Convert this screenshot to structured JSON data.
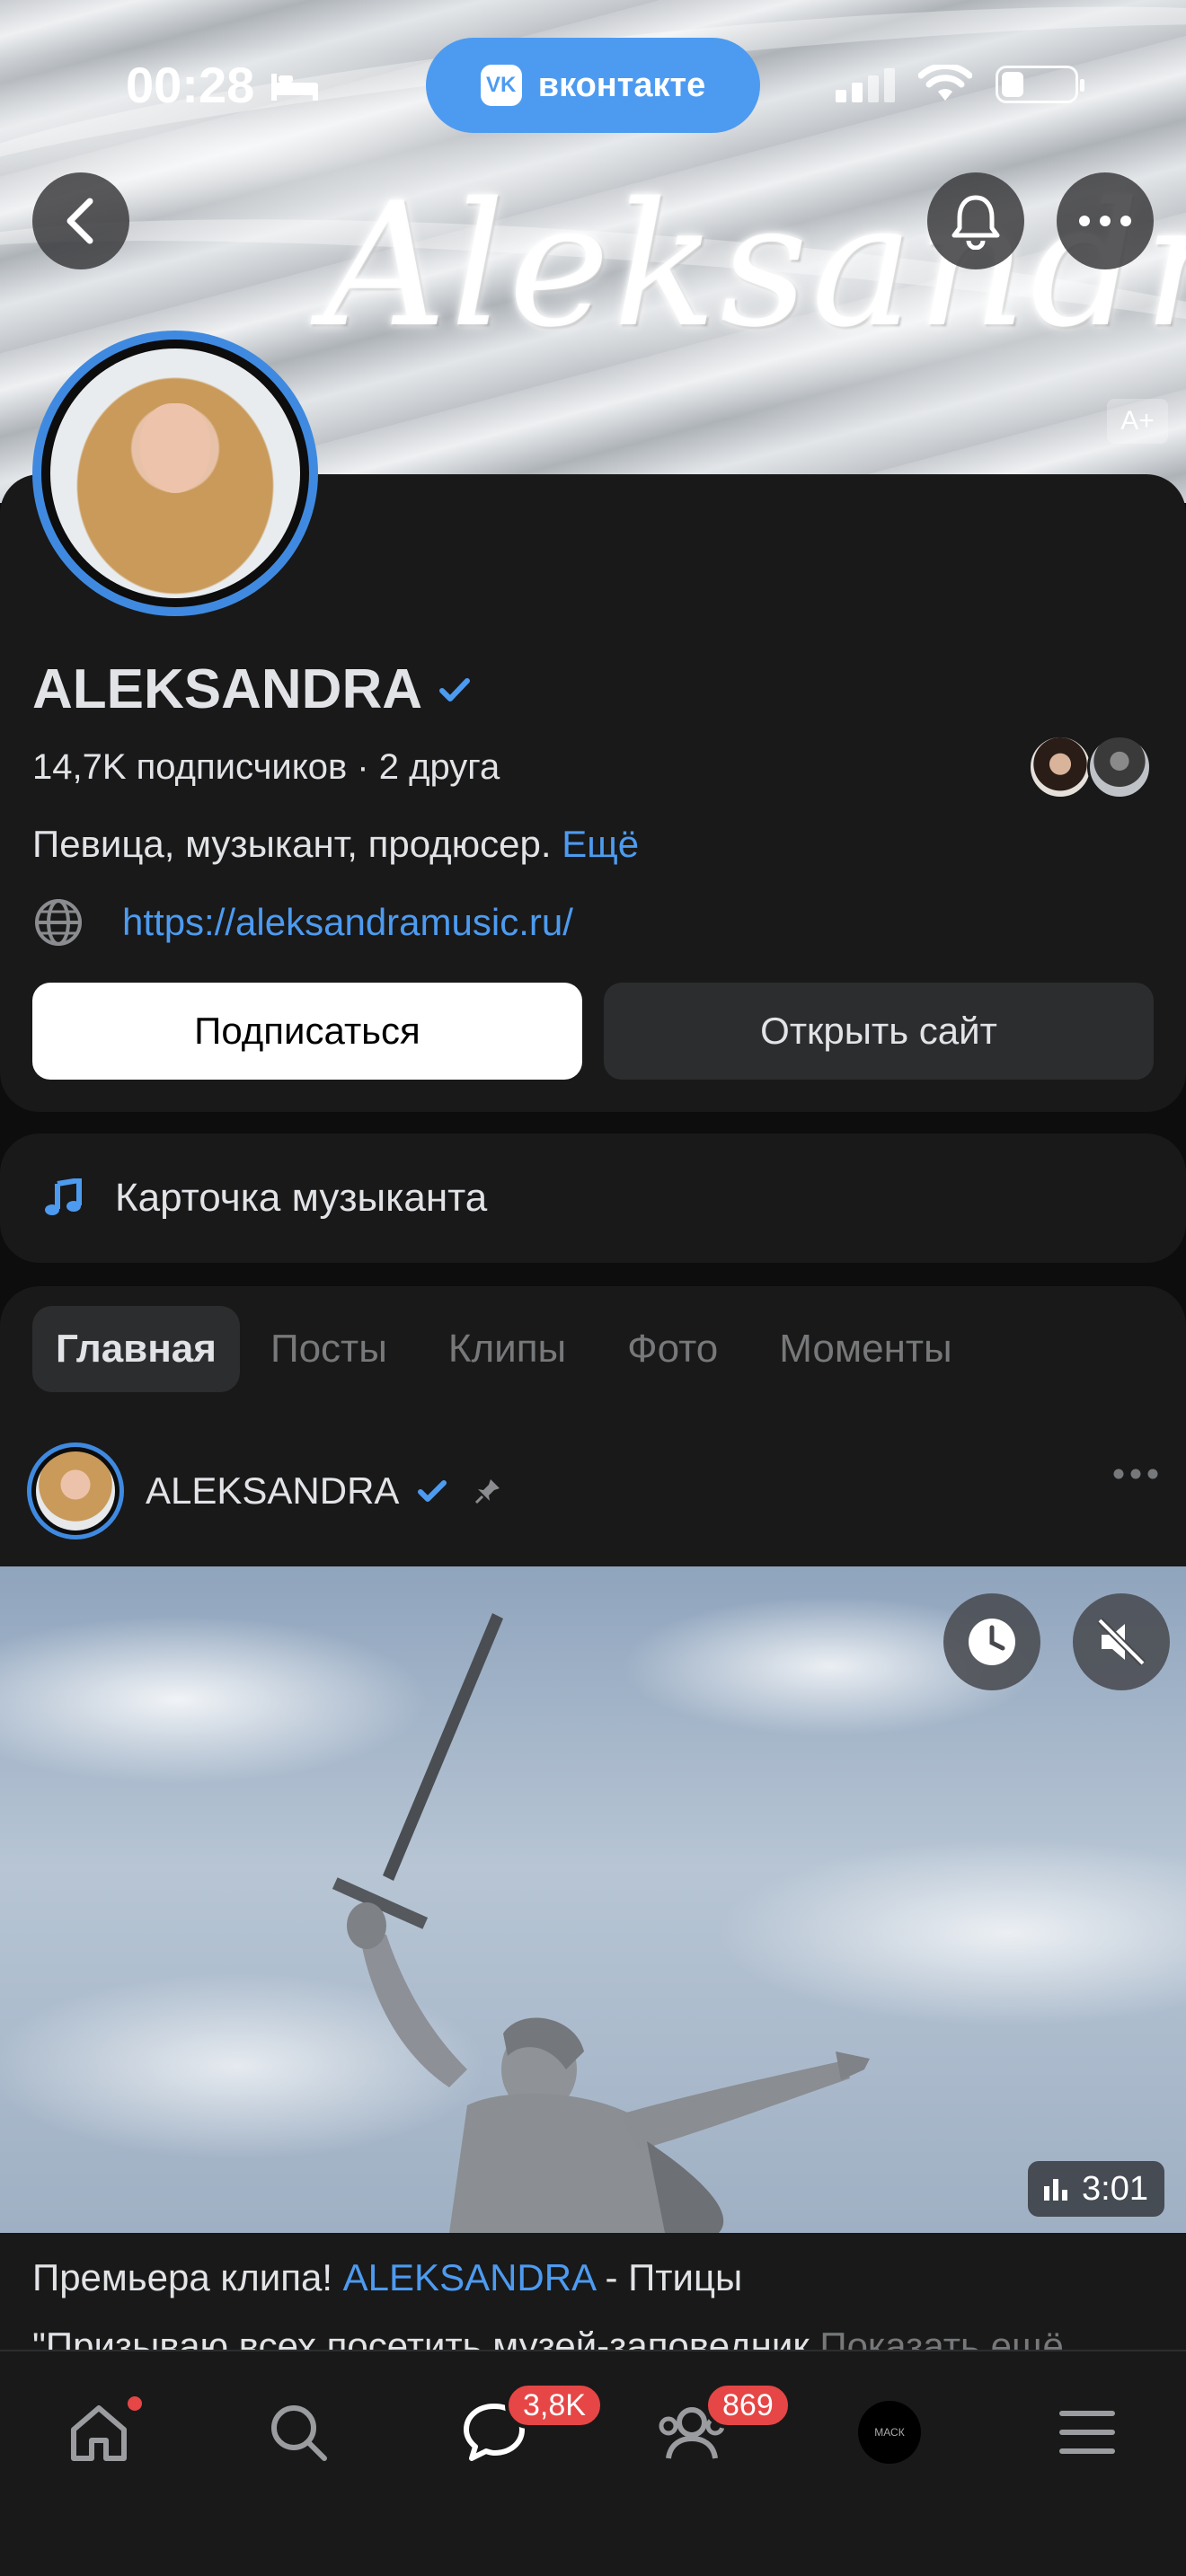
{
  "status_bar": {
    "time": "00:28",
    "app_pill": "вконтакте",
    "vk_logo": "VK"
  },
  "cover": {
    "script_text": "Aleksandra",
    "font_size_button": "A+"
  },
  "profile": {
    "name": "ALEKSANDRA",
    "subscribers_text": "14,7K подписчиков · 2 друга",
    "bio": "Певица, музыкант, продюсер.",
    "bio_more": "Ещё",
    "website": "https://aleksandramusic.ru/",
    "subscribe_label": "Подписаться",
    "open_site_label": "Открыть сайт"
  },
  "musician_card": {
    "label": "Карточка музыканта"
  },
  "tabs": [
    {
      "label": "Главная",
      "active": true
    },
    {
      "label": "Посты"
    },
    {
      "label": "Клипы"
    },
    {
      "label": "Фото"
    },
    {
      "label": "Моменты"
    }
  ],
  "post": {
    "author": "ALEKSANDRA",
    "duration": "3:01",
    "text_prefix": "Премьера клипа! ",
    "text_link": "ALEKSANDRA",
    "text_suffix": " - Птицы",
    "text_line2": "\"Призываю всех посетить музей-заповедник",
    "text_line2_more": "Показать ещё"
  },
  "tabbar": {
    "messages_badge": "3,8K",
    "friends_badge": "869",
    "mask_label": "МАСК"
  },
  "colors": {
    "accent": "#4d9bf0",
    "badge": "#e64646",
    "card_bg": "#191919"
  }
}
